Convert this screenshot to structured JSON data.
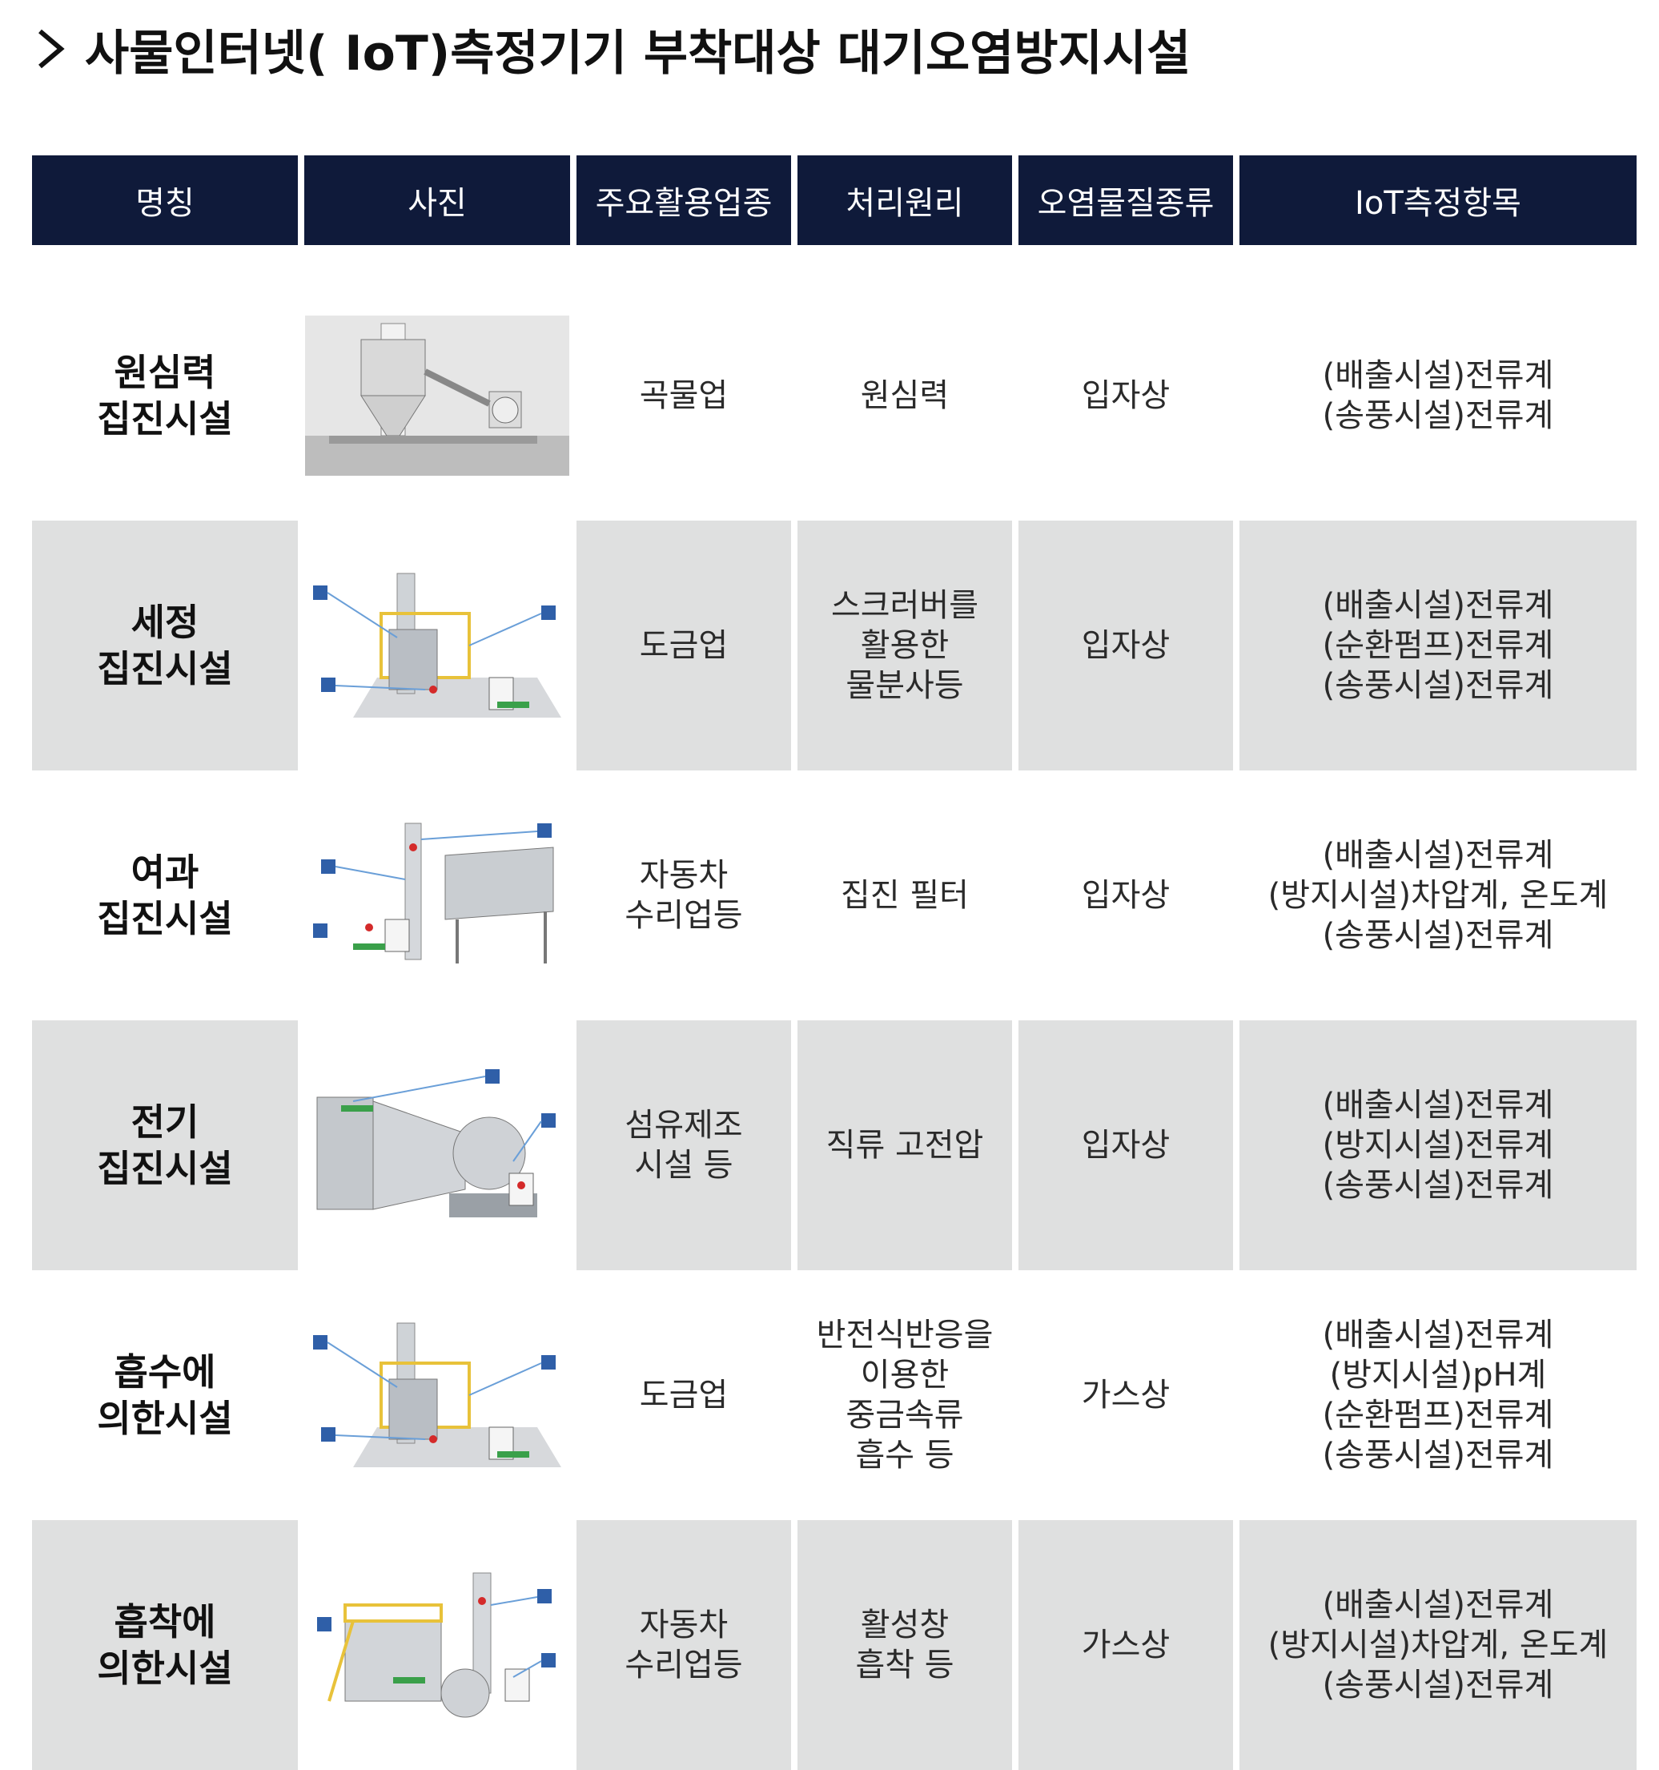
{
  "title": "사물인터넷( IoT)측정기기 부착대상 대기오염방지시설",
  "headers": [
    "명칭",
    "사진",
    "주요활용업종",
    "처리원리",
    "오염물질종류",
    "IoT측정항목"
  ],
  "rows": [
    {
      "name": "원심력\n집진시설",
      "industry": "곡물업",
      "principle": "원심력",
      "pollutant": "입자상",
      "iot": "(배출시설)전류계\n(송풍시설)전류계",
      "photo_icon": "cyclone-dust-collector-photo"
    },
    {
      "name": "세정\n집진시설",
      "industry": "도금업",
      "principle": "스크러버를\n활용한\n물분사등",
      "pollutant": "입자상",
      "iot": "(배출시설)전류계\n(순환펌프)전류계\n(송풍시설)전류계",
      "photo_icon": "scrubber-tower-diagram"
    },
    {
      "name": "여과\n집진시설",
      "industry": "자동차\n수리업등",
      "principle": "집진 필터",
      "pollutant": "입자상",
      "iot": "(배출시설)전류계\n(방지시설)차압계, 온도계\n(송풍시설)전류계",
      "photo_icon": "bag-filter-diagram"
    },
    {
      "name": "전기\n집진시설",
      "industry": "섬유제조\n시설 등",
      "principle": "직류 고전압",
      "pollutant": "입자상",
      "iot": "(배출시설)전류계\n(방지시설)전류계\n(송풍시설)전류계",
      "photo_icon": "electrostatic-precipitator-diagram"
    },
    {
      "name": "흡수에\n의한시설",
      "industry": "도금업",
      "principle": "반전식반응을\n이용한\n중금속류\n흡수 등",
      "pollutant": "가스상",
      "iot": "(배출시설)전류계\n(방지시설)pH계\n(순환펌프)전류계\n(송풍시설)전류계",
      "photo_icon": "absorption-tower-diagram"
    },
    {
      "name": "흡착에\n의한시설",
      "industry": "자동차\n수리업등",
      "principle": "활성창\n흡착 등",
      "pollutant": "가스상",
      "iot": "(배출시설)전류계\n(방지시설)차압계, 온도계\n(송풍시설)전류계",
      "photo_icon": "adsorption-tower-diagram"
    }
  ],
  "colors": {
    "header_bg": "#0f1a3a",
    "shade": "#dfe0e0",
    "steel": "#c8ccd0",
    "railing": "#e8c23a",
    "sensor_blue": "#2f5fa8",
    "label_green": "#3aa04a",
    "alarm_red": "#d42a2a"
  }
}
